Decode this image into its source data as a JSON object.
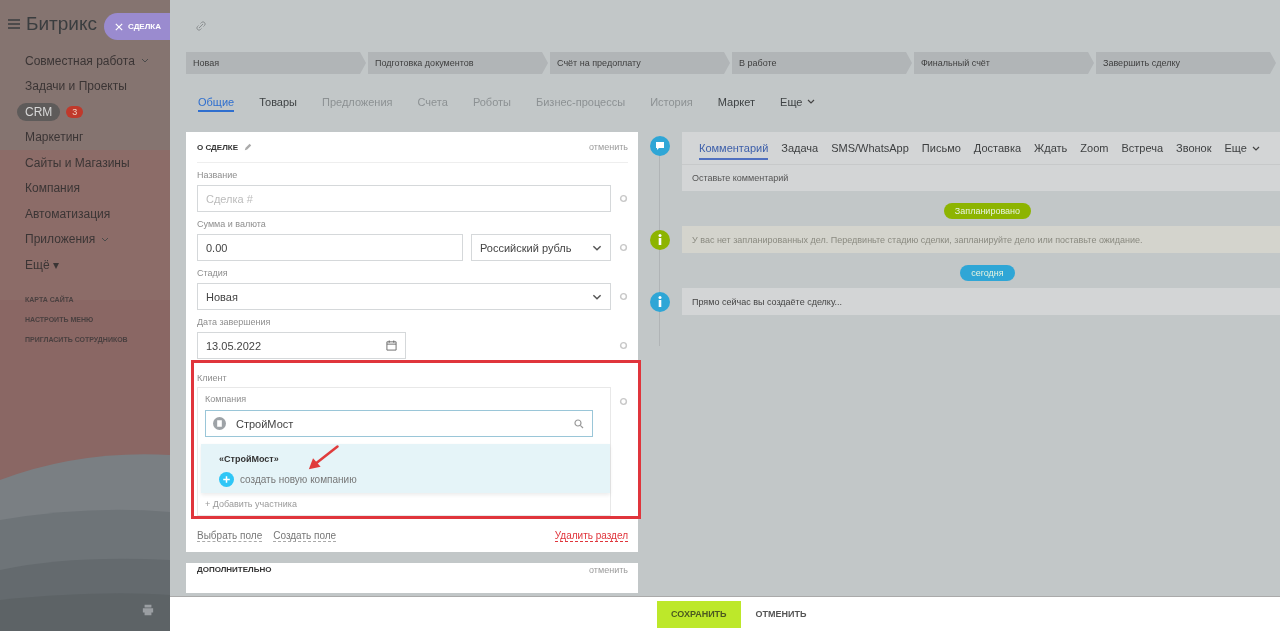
{
  "sidebar": {
    "logo": "Битрикс",
    "items": [
      {
        "label": "Совместная работа",
        "expandable": true,
        "selected": false
      },
      {
        "label": "Задачи и Проекты",
        "expandable": false,
        "selected": false
      },
      {
        "label": "CRM",
        "expandable": false,
        "selected": true,
        "counter": "3"
      },
      {
        "label": "Маркетинг",
        "expandable": false,
        "selected": false
      },
      {
        "label": "Сайты и Магазины",
        "expandable": false,
        "selected": false
      },
      {
        "label": "Компания",
        "expandable": false,
        "selected": false
      },
      {
        "label": "Автоматизация",
        "expandable": false,
        "selected": false
      },
      {
        "label": "Приложения",
        "expandable": true,
        "selected": false
      },
      {
        "label": "Ещё ▾",
        "expandable": false,
        "selected": false
      }
    ],
    "links": [
      "КАРТА САЙТА",
      "НАСТРОИТЬ МЕНЮ",
      "ПРИГЛАСИТЬ СОТРУДНИКОВ"
    ]
  },
  "slider_tag": {
    "label": "СДЕЛКА"
  },
  "stages": [
    "Новая",
    "Подготовка документов",
    "Счёт на предоплату",
    "В работе",
    "Финальный счёт",
    "Завершить сделку"
  ],
  "tabs": [
    {
      "label": "Общие",
      "selected": true,
      "disabled": false
    },
    {
      "label": "Товары",
      "selected": false,
      "disabled": false
    },
    {
      "label": "Предложения",
      "selected": false,
      "disabled": true
    },
    {
      "label": "Счета",
      "selected": false,
      "disabled": true
    },
    {
      "label": "Роботы",
      "selected": false,
      "disabled": true
    },
    {
      "label": "Бизнес-процессы",
      "selected": false,
      "disabled": true
    },
    {
      "label": "История",
      "selected": false,
      "disabled": true
    },
    {
      "label": "Маркет",
      "selected": false,
      "disabled": false
    }
  ],
  "tabs_more": "Еще",
  "deal_section": {
    "title": "О СДЕЛКЕ",
    "cancel": "отменить",
    "fields": [
      {
        "kind": "text",
        "label": "Название",
        "placeholder": "Сделка #"
      },
      {
        "kind": "money",
        "label": "Сумма и валюта",
        "value": "0.00",
        "currency": "Российский рубль"
      },
      {
        "kind": "select",
        "label": "Стадия",
        "value": "Новая"
      },
      {
        "kind": "date",
        "label": "Дата завершения",
        "value": "13.05.2022"
      }
    ],
    "client": {
      "label": "Клиент",
      "company_label": "Компания",
      "value": "СтройМост",
      "suggestions": [
        {
          "kind": "company",
          "label": "«СтройМост»"
        },
        {
          "kind": "create",
          "label": "создать новую компанию"
        }
      ],
      "add_participant": "+ Добавить участника"
    },
    "links": [
      {
        "label": "Выбрать поле",
        "kind": "plain"
      },
      {
        "label": "Создать поле",
        "kind": "plain"
      },
      {
        "label": "Удалить раздел",
        "kind": "danger"
      }
    ]
  },
  "extra_section": {
    "title": "ДОПОЛНИТЕЛЬНО",
    "cancel": "отменить"
  },
  "timeline": {
    "tabs": [
      {
        "label": "Комментарий",
        "selected": true
      },
      {
        "label": "Задача",
        "selected": false
      },
      {
        "label": "SMS/WhatsApp",
        "selected": false
      },
      {
        "label": "Письмо",
        "selected": false
      },
      {
        "label": "Доставка",
        "selected": false
      },
      {
        "label": "Ждать",
        "selected": false
      },
      {
        "label": "Zoom",
        "selected": false
      },
      {
        "label": "Встреча",
        "selected": false
      },
      {
        "label": "Звонок",
        "selected": false
      }
    ],
    "more": "Еще",
    "comment_placeholder": "Оставьте комментарий",
    "entries": [
      {
        "kind": "badge",
        "label": "Запланировано",
        "color": "#8db400"
      },
      {
        "kind": "info",
        "text": "У вас нет запланированных дел. Передвиньте стадию сделки, запланируйте дело или поставьте ожидание.",
        "color": "#8db400"
      },
      {
        "kind": "badge",
        "label": "сегодня",
        "color": "#2fa6d6"
      },
      {
        "kind": "info",
        "text": "Прямо сейчас вы создаёте сделку...",
        "color": "#2fa6d6"
      }
    ]
  },
  "actions": {
    "save": "СОХРАНИТЬ",
    "cancel": "ОТМЕНИТЬ"
  }
}
